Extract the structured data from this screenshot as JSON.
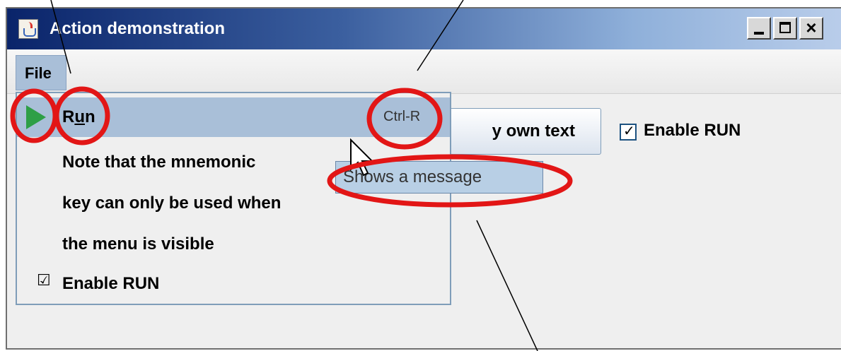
{
  "window": {
    "title": "Action demonstration",
    "controls": {
      "minimize": "minimize",
      "maximize": "maximize",
      "close": "close"
    }
  },
  "menubar": {
    "file_label": "File"
  },
  "content": {
    "button_label": "y own text",
    "checkbox_label": "Enable RUN",
    "checkbox_checked": true
  },
  "menu": {
    "run_label_prefix": "R",
    "run_label_mnemonic": "u",
    "run_label_suffix": "n",
    "run_accelerator": "Ctrl-R",
    "run_icon": "play-icon",
    "notes": [
      "Note that the mnemonic",
      "key can only be used when",
      "the menu is visible"
    ],
    "enable_run_label": "Enable RUN",
    "enable_run_checked": true
  },
  "tooltip": {
    "text": "Shows a message"
  },
  "colors": {
    "titlebar_start": "#0a246a",
    "titlebar_end": "#b9cdea",
    "selection": "#a9bfd8",
    "play_icon": "#2e9f46",
    "annotation": "#e21616"
  }
}
